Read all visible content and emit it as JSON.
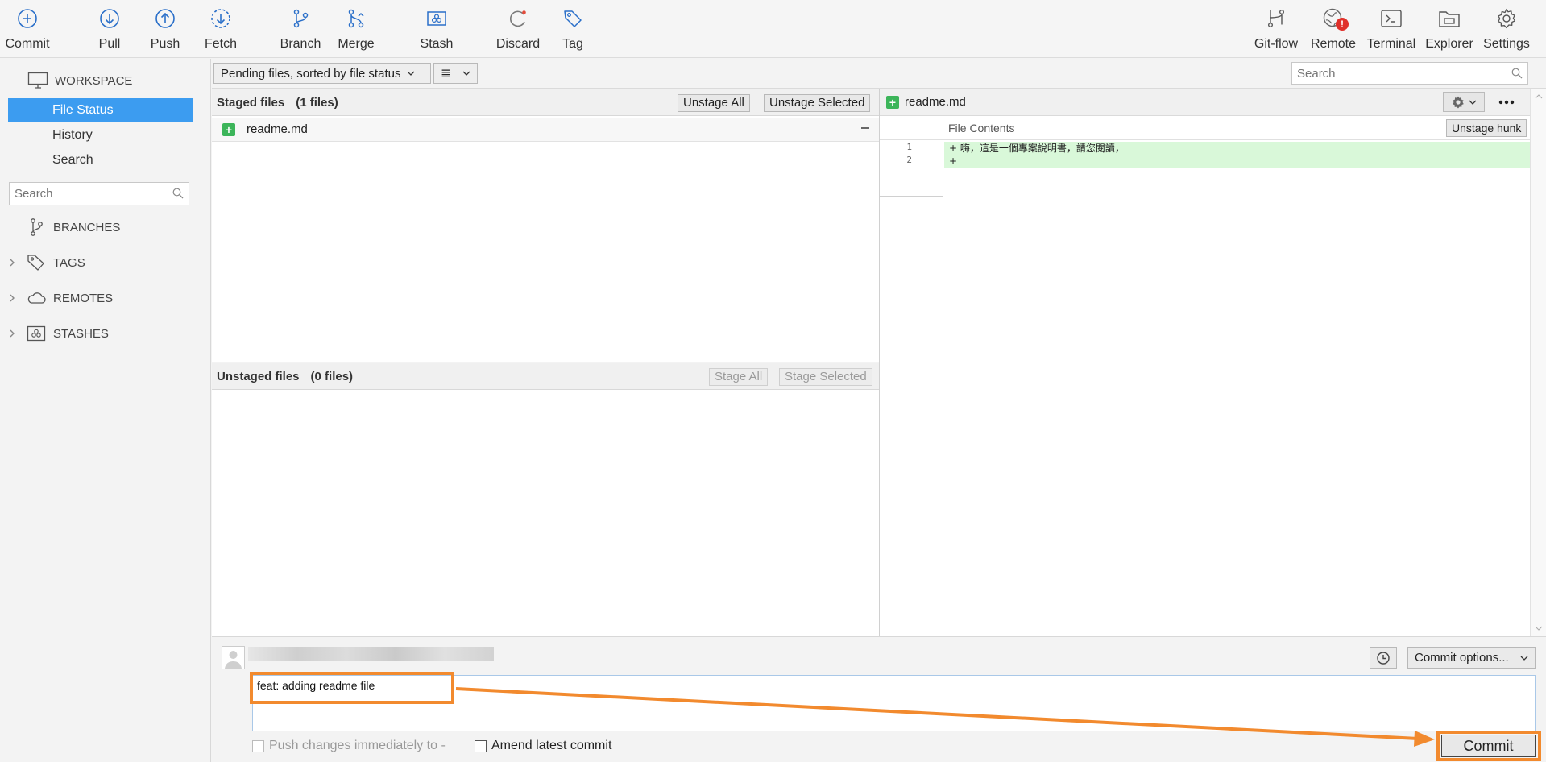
{
  "toolbar": {
    "commit": "Commit",
    "pull": "Pull",
    "push": "Push",
    "fetch": "Fetch",
    "branch": "Branch",
    "merge": "Merge",
    "stash": "Stash",
    "discard": "Discard",
    "tag": "Tag",
    "gitflow": "Git-flow",
    "remote": "Remote",
    "terminal": "Terminal",
    "explorer": "Explorer",
    "settings": "Settings",
    "remote_badge": "!"
  },
  "sidebar": {
    "workspace": "WORKSPACE",
    "items": [
      "File Status",
      "History",
      "Search"
    ],
    "search_placeholder": "Search",
    "sections": [
      "BRANCHES",
      "TAGS",
      "REMOTES",
      "STASHES"
    ]
  },
  "filter": {
    "sort_label": "Pending files, sorted by file status",
    "view_label": "≣",
    "search_placeholder": "Search"
  },
  "staged": {
    "title": "Staged files",
    "count": "(1 files)",
    "unstage_all": "Unstage All",
    "unstage_selected": "Unstage Selected",
    "files": [
      "readme.md"
    ]
  },
  "unstaged": {
    "title": "Unstaged files",
    "count": "(0 files)",
    "stage_all": "Stage All",
    "stage_selected": "Stage Selected"
  },
  "diff": {
    "filename": "readme.md",
    "sub_label": "File Contents",
    "unstage_hunk": "Unstage hunk",
    "line_numbers": [
      "1",
      "2"
    ],
    "lines": [
      "+ 嗨，這是一個專案說明書，請您閱讀，",
      "+"
    ]
  },
  "commit": {
    "message": "feat: adding readme file",
    "options_label": "Commit options...",
    "push_label": "Push changes immediately to -",
    "amend_label": "Amend latest commit",
    "commit_button": "Commit"
  },
  "colors": {
    "accent": "#3c9cf0",
    "annotation": "#f28a2e",
    "added": "#3cb55a",
    "diff_added_bg": "#d9f8d9"
  }
}
